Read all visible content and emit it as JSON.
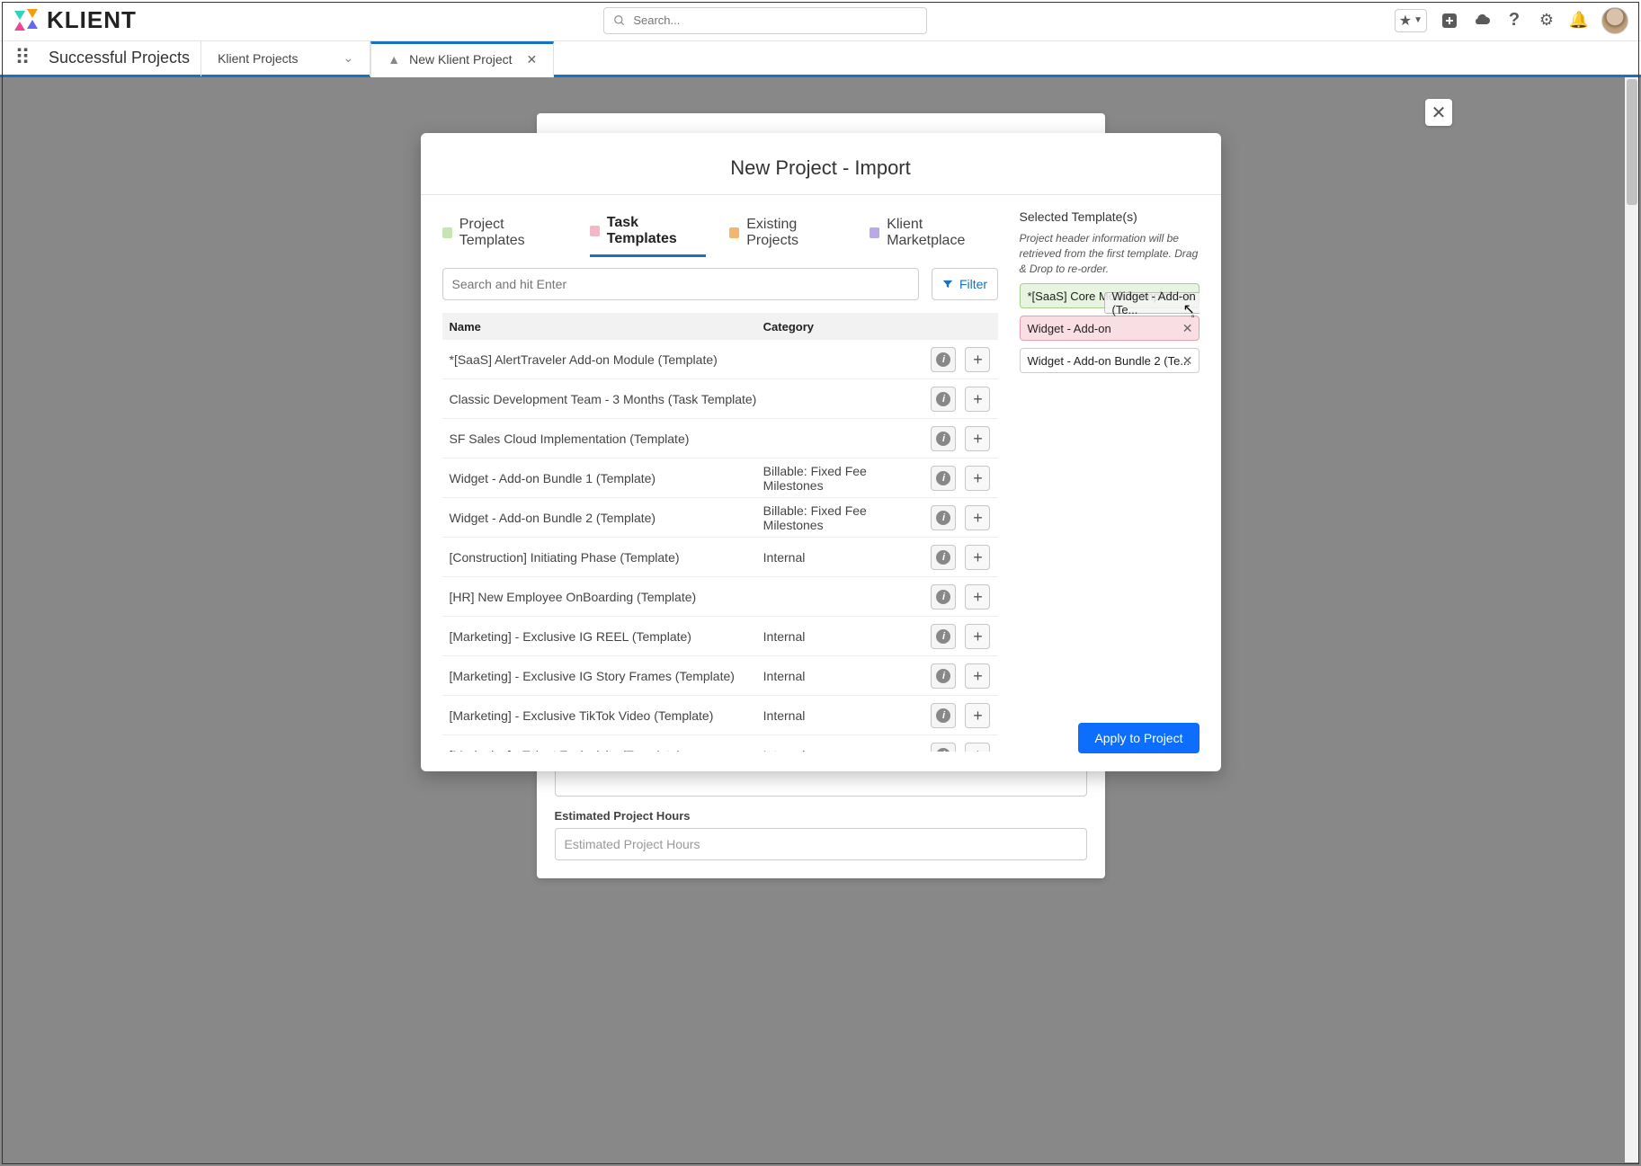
{
  "logo_text": "KLIENT",
  "search_placeholder": "Search...",
  "workspace": "Successful Projects",
  "nav_tabs": [
    {
      "label": "Klient Projects"
    },
    {
      "label": "New Klient Project"
    }
  ],
  "bg_field_label": "Estimated Project Hours",
  "bg_field_placeholder": "Estimated Project Hours",
  "modal": {
    "title": "New Project - Import",
    "tab_labels": {
      "project_templates": "Project Templates",
      "task_templates": "Task Templates",
      "existing_projects": "Existing Projects",
      "marketplace": "Klient Marketplace"
    },
    "tab_colors": {
      "project_templates": "#c5e6b4",
      "task_templates": "#f2b8c6",
      "existing_projects": "#f2b66d",
      "marketplace": "#b9a9e6"
    },
    "search_placeholder": "Search and hit Enter",
    "filter_label": "Filter",
    "columns": {
      "name": "Name",
      "category": "Category"
    },
    "rows": [
      {
        "name": "*[SaaS] AlertTraveler Add-on Module (Template)",
        "category": ""
      },
      {
        "name": "Classic Development Team - 3 Months (Task Template)",
        "category": ""
      },
      {
        "name": "SF Sales Cloud Implementation (Template)",
        "category": ""
      },
      {
        "name": "Widget - Add-on Bundle 1 (Template)",
        "category": "Billable: Fixed Fee Milestones"
      },
      {
        "name": "Widget - Add-on Bundle 2 (Template)",
        "category": "Billable: Fixed Fee Milestones"
      },
      {
        "name": "[Construction] Initiating Phase (Template)",
        "category": "Internal"
      },
      {
        "name": "[HR] New Employee OnBoarding (Template)",
        "category": ""
      },
      {
        "name": "[Marketing] - Exclusive IG REEL (Template)",
        "category": "Internal"
      },
      {
        "name": "[Marketing] - Exclusive IG Story Frames (Template)",
        "category": "Internal"
      },
      {
        "name": "[Marketing] - Exclusive TikTok Video (Template)",
        "category": "Internal"
      },
      {
        "name": "[Marketing] - Talent Exclusivity (Template)",
        "category": "Internal"
      }
    ],
    "selected_title": "Selected Template(s)",
    "selected_note": "Project header information will be retrieved from the first template. Drag & Drop to re-order.",
    "selected": [
      {
        "label": "*[SaaS] Core Module Impleme...",
        "style": "green"
      },
      {
        "label": "Widget - Add-on",
        "style": "pink"
      },
      {
        "label": "Widget - Add-on Bundle 2 (Te...",
        "style": "plain"
      }
    ],
    "drag_ghost": "Widget - Add-on Bundle 2 (Te...",
    "apply_label": "Apply to Project"
  }
}
